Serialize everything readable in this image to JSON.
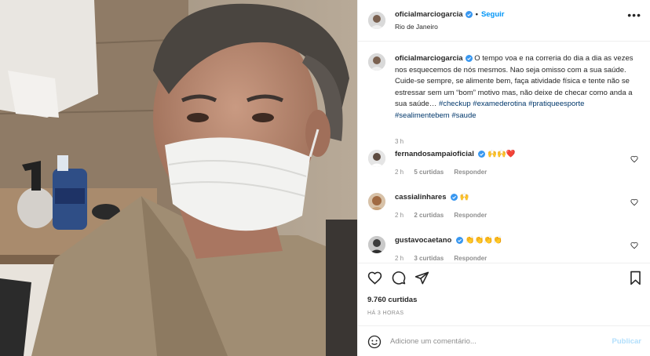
{
  "post": {
    "photo_alt": "Selfie com máscara",
    "author": "oficialmarciogarcia",
    "follow_label": "Seguir",
    "separator": "•",
    "location": "Rio de Janeiro",
    "more_icon": "more-horizontal-icon",
    "caption": {
      "text": " O tempo voa e na correria do dia a dia as vezes nos esquecemos de nós mesmos. Nao seja omisso com a sua saúde. Cuide-se sempre, se alimente bem, faça atividade física e tente não se estressar sem um “bom” motivo mas, não deixe de checar como anda a sua saúde… ",
      "hashtags": [
        "#checkup",
        "#examederotina",
        "#pratiqueesporte",
        "#sealimentebem",
        "#saude"
      ],
      "time": "3 h"
    }
  },
  "comments": [
    {
      "user": "fernandosampaioficial",
      "text": "🙌🙌❤️",
      "time": "2 h",
      "likes": "5 curtidas",
      "reply": "Responder"
    },
    {
      "user": "cassialinhares",
      "text": "🙌",
      "time": "2 h",
      "likes": "2 curtidas",
      "reply": "Responder"
    },
    {
      "user": "gustavocaetano",
      "text": "👏👏👏👏",
      "time": "2 h",
      "likes": "3 curtidas",
      "reply": "Responder"
    }
  ],
  "actions": {
    "likes": "9.760 curtidas",
    "posted": "HÁ 3 HORAS",
    "icons": [
      "heart-icon",
      "comment-icon",
      "share-icon",
      "bookmark-icon"
    ]
  },
  "add_comment": {
    "placeholder": "Adicione um comentário...",
    "publish_label": "Publicar"
  },
  "colors": {
    "accent": "#0095f6",
    "hashtag": "#00376b",
    "muted": "#8e8e8e",
    "publish_disabled": "#b2dffc"
  }
}
